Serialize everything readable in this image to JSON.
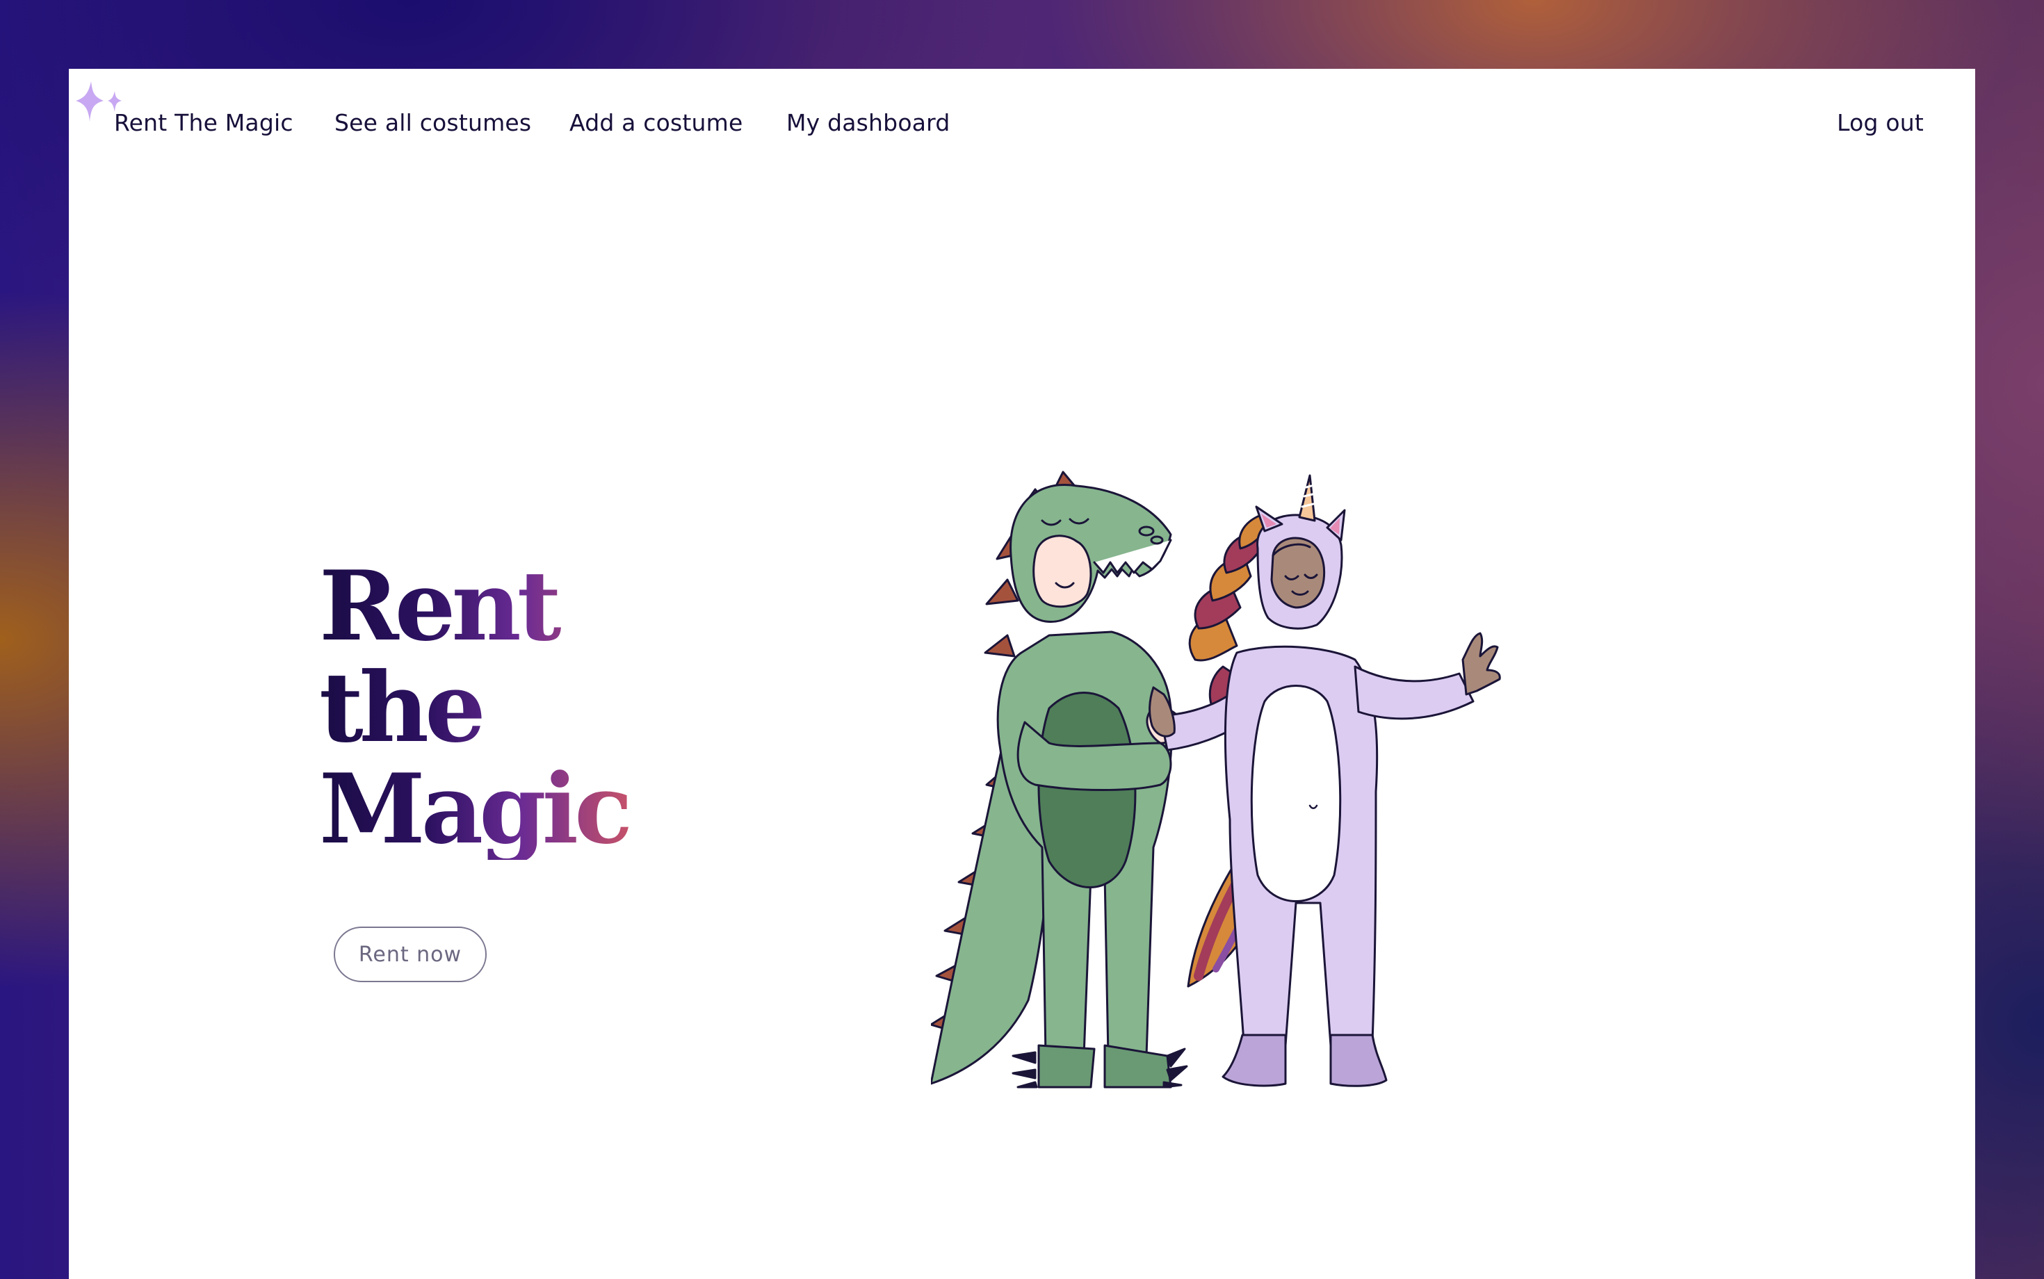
{
  "nav": {
    "brand": "Rent The Magic",
    "links": [
      "See all costumes",
      "Add a costume",
      "My dashboard"
    ],
    "logout": "Log out"
  },
  "hero": {
    "title_lines": [
      "Rent",
      "the",
      "Magic"
    ],
    "cta_label": "Rent now"
  },
  "colors": {
    "dino_body": "#86b58e",
    "dino_belly": "#4f7e59",
    "dino_spikes": "#a5523d",
    "unicorn_body": "#dcccf2",
    "unicorn_feet": "#bba5d8",
    "skin_light": "#fde3da",
    "skin_dark": "#a98a7a",
    "outline": "#1b1538",
    "title_gradient_start": "#1a0c45",
    "title_gradient_end": "#c4516a",
    "sparkle": "#c8a8f2"
  },
  "icons": {
    "logo": "sparkle-icon"
  }
}
